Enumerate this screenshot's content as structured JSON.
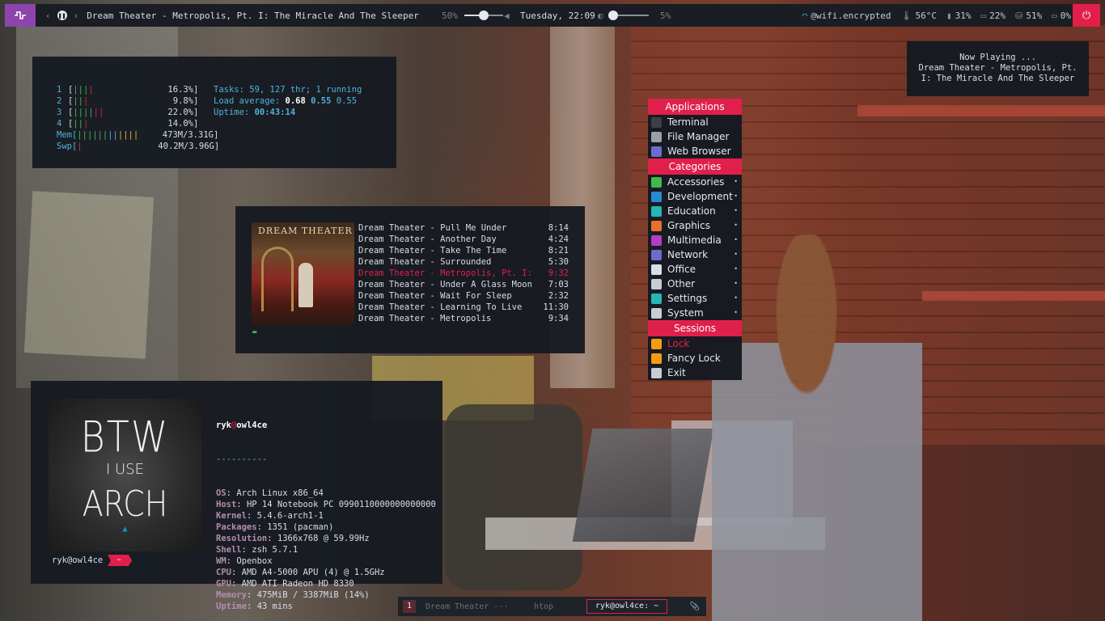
{
  "topbar": {
    "launcher_icon": "pulse-icon",
    "track": "Dream Theater - Metropolis, Pt. I: The Miracle And The Sleeper",
    "volume_pct": "50%",
    "volume_level": 0.5,
    "datetime": "Tuesday, 22:09",
    "brightness_pct": "5%",
    "brightness_level": 0.05,
    "wifi": "@wifi.encrypted",
    "temp": "56°C",
    "battery": "31%",
    "ram": "22%",
    "disk": "51%",
    "swap": "0%",
    "accent": "#e0204a"
  },
  "htop": {
    "cpus": [
      {
        "n": "1",
        "bars_green": "|||",
        "bars_red": "|",
        "pct": "16.3%]"
      },
      {
        "n": "2",
        "bars_green": "||",
        "bars_red": "|",
        "pct": "9.8%]"
      },
      {
        "n": "3",
        "bars_green": "||||",
        "bars_red": "||",
        "pct": "22.0%]"
      },
      {
        "n": "4",
        "bars_green": "||",
        "bars_red": "|",
        "pct": "14.0%]"
      }
    ],
    "mem_label": "Mem[",
    "mem_bars_green": "||||||",
    "mem_bars_blue": "||",
    "mem_bars_yellow": "||||",
    "mem_val": "473M/3.31G]",
    "swp_label": "Swp[",
    "swp_bars": "|",
    "swp_val": "40.2M/3.96G]",
    "tasks_label": "Tasks: ",
    "tasks_val": "59, 127 thr; 1 running",
    "load_label": "Load average: ",
    "load_1": "0.68",
    "load_5": "0.55",
    "load_15": "0.55",
    "uptime_label": "Uptime: ",
    "uptime_val": "00:43:14"
  },
  "nowplaying": {
    "header": "Now Playing ...",
    "line1": "Dream Theater - Metropolis, Pt.",
    "line2": "I: The Miracle And The Sleeper"
  },
  "mpd": {
    "cover_band": "DREAM THEATER",
    "playlist": [
      {
        "name": "Dream Theater - Pull Me Under",
        "time": "8:14",
        "active": false
      },
      {
        "name": "Dream Theater - Another Day",
        "time": "4:24",
        "active": false
      },
      {
        "name": "Dream Theater - Take The Time",
        "time": "8:21",
        "active": false
      },
      {
        "name": "Dream Theater - Surrounded",
        "time": "5:30",
        "active": false
      },
      {
        "name": "Dream Theater - Metropolis, Pt. I: T",
        "time": "9:32",
        "active": true
      },
      {
        "name": "Dream Theater - Under A Glass Moon",
        "time": "7:03",
        "active": false
      },
      {
        "name": "Dream Theater - Wait For Sleep",
        "time": "2:32",
        "active": false
      },
      {
        "name": "Dream Theater - Learning To Live",
        "time": "11:30",
        "active": false
      },
      {
        "name": "Dream Theater - Metropolis",
        "time": "9:34",
        "active": false
      }
    ],
    "cursor": "▬"
  },
  "neofetch": {
    "logo_line1": "BTW",
    "logo_line2": "I USE",
    "logo_line3": "ARCH",
    "user": "ryk",
    "at": "@",
    "host": "owl4ce",
    "dashes": "----------",
    "rows": [
      {
        "key": "OS",
        "val": "Arch Linux x86_64"
      },
      {
        "key": "Host",
        "val": "HP 14 Notebook PC 0990110000000000000"
      },
      {
        "key": "Kernel",
        "val": "5.4.6-arch1-1"
      },
      {
        "key": "Packages",
        "val": "1351 (pacman)"
      },
      {
        "key": "Resolution",
        "val": "1366x768 @ 59.99Hz"
      },
      {
        "key": "Shell",
        "val": "zsh 5.7.1"
      },
      {
        "key": "WM",
        "val": "Openbox"
      },
      {
        "key": "CPU",
        "val": "AMD A4-5000 APU (4) @ 1.5GHz"
      },
      {
        "key": "GPU",
        "val": "AMD ATI Radeon HD 8330"
      },
      {
        "key": "Memory",
        "val": "475MiB / 3387MiB (14%)"
      },
      {
        "key": "Uptime",
        "val": "43 mins"
      }
    ],
    "prompt_user": "ryk@owl4ce",
    "prompt_dir": "~"
  },
  "menu": {
    "applications_header": "Applications",
    "applications": [
      {
        "label": "Terminal",
        "icon": "terminal-icon",
        "color": "#3b3f46"
      },
      {
        "label": "File Manager",
        "icon": "file-manager-icon",
        "color": "#9aa0a8"
      },
      {
        "label": "Web Browser",
        "icon": "web-browser-icon",
        "color": "#6c6cd0"
      }
    ],
    "categories_header": "Categories",
    "categories": [
      {
        "label": "Accessories",
        "icon": "accessories-icon",
        "color": "#3fb950"
      },
      {
        "label": "Development",
        "icon": "development-icon",
        "color": "#2a8ad4"
      },
      {
        "label": "Education",
        "icon": "education-icon",
        "color": "#28b4b4"
      },
      {
        "label": "Graphics",
        "icon": "graphics-icon",
        "color": "#e8702a"
      },
      {
        "label": "Multimedia",
        "icon": "multimedia-icon",
        "color": "#b040c0"
      },
      {
        "label": "Network",
        "icon": "network-icon",
        "color": "#6c6cd0"
      },
      {
        "label": "Office",
        "icon": "office-icon",
        "color": "#d8dee9"
      },
      {
        "label": "Other",
        "icon": "other-icon",
        "color": "#c8ccd4"
      },
      {
        "label": "Settings",
        "icon": "settings-icon",
        "color": "#28b4b4"
      },
      {
        "label": "System",
        "icon": "system-icon",
        "color": "#c8ccd4"
      }
    ],
    "sessions_header": "Sessions",
    "sessions": [
      {
        "label": "Lock",
        "icon": "lock-icon",
        "color": "#f39c12",
        "active": true
      },
      {
        "label": "Fancy Lock",
        "icon": "fancy-lock-icon",
        "color": "#f39c12",
        "active": false
      },
      {
        "label": "Exit",
        "icon": "exit-icon",
        "color": "#c8ccd4",
        "active": false
      }
    ],
    "arrow": "•"
  },
  "taskbar": {
    "workspace": "1",
    "tasks": [
      "Dream Theater ···",
      "htop"
    ],
    "active_task": "ryk@owl4ce: ~"
  }
}
